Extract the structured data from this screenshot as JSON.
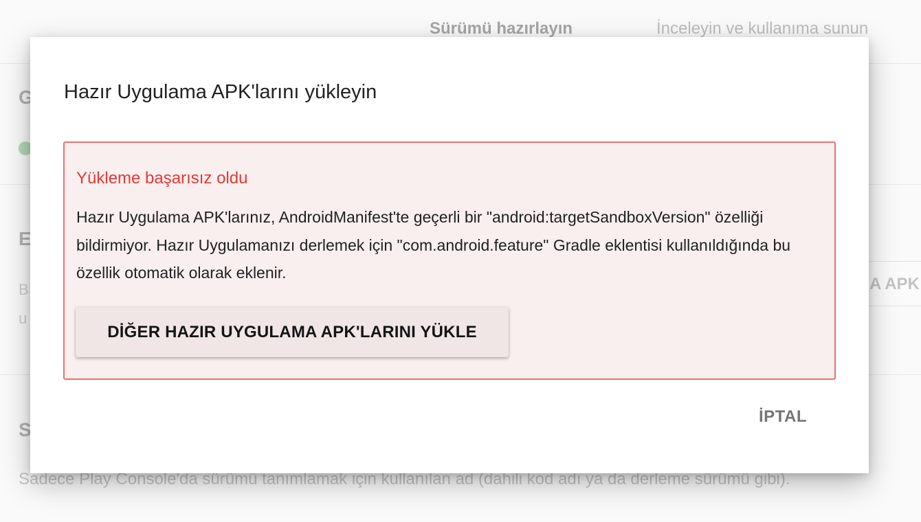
{
  "background": {
    "steps": [
      {
        "label": "Sürümü hazırlayın"
      },
      {
        "label": "İnceleyin ve kullanıma sunun"
      }
    ],
    "section_letters": [
      "G",
      "E",
      "S"
    ],
    "side_fragments": [
      "B",
      "u"
    ],
    "right_button_label": "A APK",
    "bottom_text": "Sadece Play Console'da sürümü tanımlamak için kullanılan ad (dahili kod adı ya da derleme sürümü gibi)."
  },
  "dialog": {
    "title": "Hazır Uygulama APK'larını yükleyin",
    "error": {
      "heading": "Yükleme başarısız oldu",
      "message": "Hazır Uygulama APK'larınız, AndroidManifest'te geçerli bir \"android:targetSandboxVersion\" özelliği bildirmiyor. Hazır Uygulamanızı derlemek için \"com.android.feature\" Gradle eklentisi kullanıldığında bu özellik otomatik olarak eklenir.",
      "button_label": "DİĞER HAZIR UYGULAMA APK'LARINI YÜKLE"
    },
    "cancel_label": "İPTAL"
  },
  "colors": {
    "error_text": "#e53935",
    "error_border": "#e57373",
    "error_background": "#f9efef",
    "success_check": "#4caf50"
  }
}
